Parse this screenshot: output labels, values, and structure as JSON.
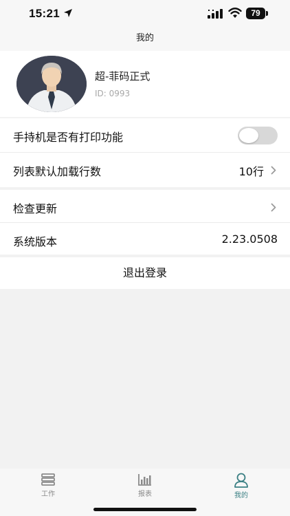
{
  "status_bar": {
    "time": "15:21",
    "battery": "79",
    "icons": [
      "location-arrow-icon",
      "cellular-signal-icon",
      "wifi-icon",
      "battery-icon"
    ]
  },
  "nav": {
    "title": "我的"
  },
  "profile": {
    "name": "超-菲码正式",
    "id": "ID: 0993"
  },
  "settings_group_1": {
    "print_label": "手持机是否有打印功能",
    "print_enabled": false,
    "rows_label": "列表默认加载行数",
    "rows_value": "10行"
  },
  "settings_group_2": {
    "update_label": "检查更新",
    "version_label": "系统版本",
    "version_value": "2.23.0508"
  },
  "logout": {
    "label": "退出登录"
  },
  "tab_bar": {
    "tabs": [
      {
        "label": "工作",
        "icon": "work-icon"
      },
      {
        "label": "报表",
        "icon": "chart-icon"
      },
      {
        "label": "我的",
        "icon": "user-icon"
      }
    ],
    "active_color": "#3a7f83",
    "inactive_color": "#8a8a8a"
  }
}
